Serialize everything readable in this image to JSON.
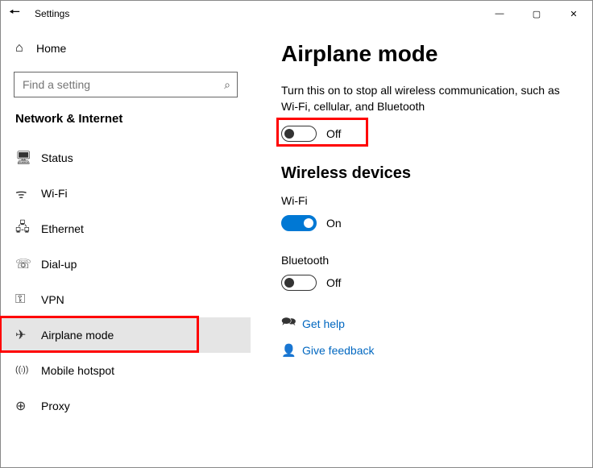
{
  "window": {
    "title": "Settings"
  },
  "sidebar": {
    "home_label": "Home",
    "search_placeholder": "Find a setting",
    "category": "Network & Internet",
    "items": [
      {
        "icon": "🖥",
        "label": "Status"
      },
      {
        "icon": "ᯤ",
        "label": "Wi-Fi"
      },
      {
        "icon": "🖧",
        "label": "Ethernet"
      },
      {
        "icon": "☏",
        "label": "Dial-up"
      },
      {
        "icon": "⚿",
        "label": "VPN"
      },
      {
        "icon": "✈",
        "label": "Airplane mode"
      },
      {
        "icon": "((၊))",
        "label": "Mobile hotspot"
      },
      {
        "icon": "⊕",
        "label": "Proxy"
      }
    ]
  },
  "main": {
    "title": "Airplane mode",
    "desc": "Turn this on to stop all wireless communication, such as Wi-Fi, cellular, and Bluetooth",
    "airplane_state": "Off",
    "wireless_header": "Wireless devices",
    "wifi_label": "Wi-Fi",
    "wifi_state": "On",
    "bluetooth_label": "Bluetooth",
    "bluetooth_state": "Off",
    "help_label": "Get help",
    "feedback_label": "Give feedback"
  }
}
